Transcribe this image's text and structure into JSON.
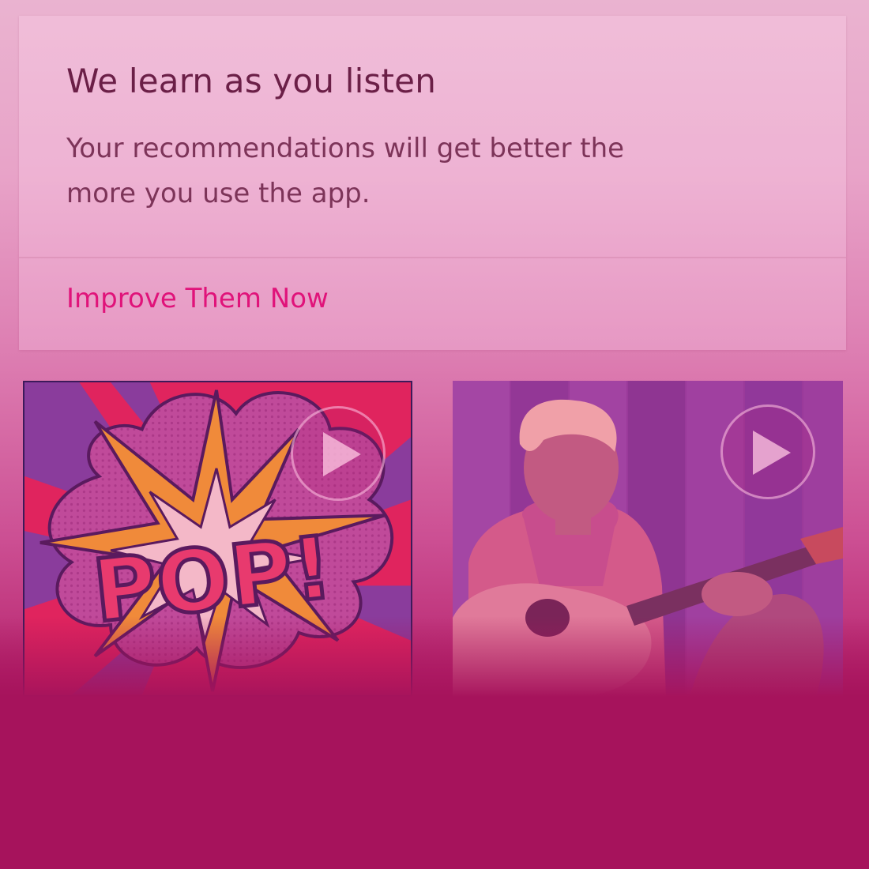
{
  "card": {
    "title": "We learn as you listen",
    "body": "Your recommendations will get better the more you use the app.",
    "action_label": "Improve Them Now"
  },
  "tiles": [
    {
      "art_text": "POP!",
      "icon": "play-icon"
    },
    {
      "icon": "play-icon"
    }
  ],
  "colors": {
    "accent": "#e0137a",
    "title": "#6b1f47",
    "body": "#7d3459",
    "background_bottom": "#a6135c"
  }
}
